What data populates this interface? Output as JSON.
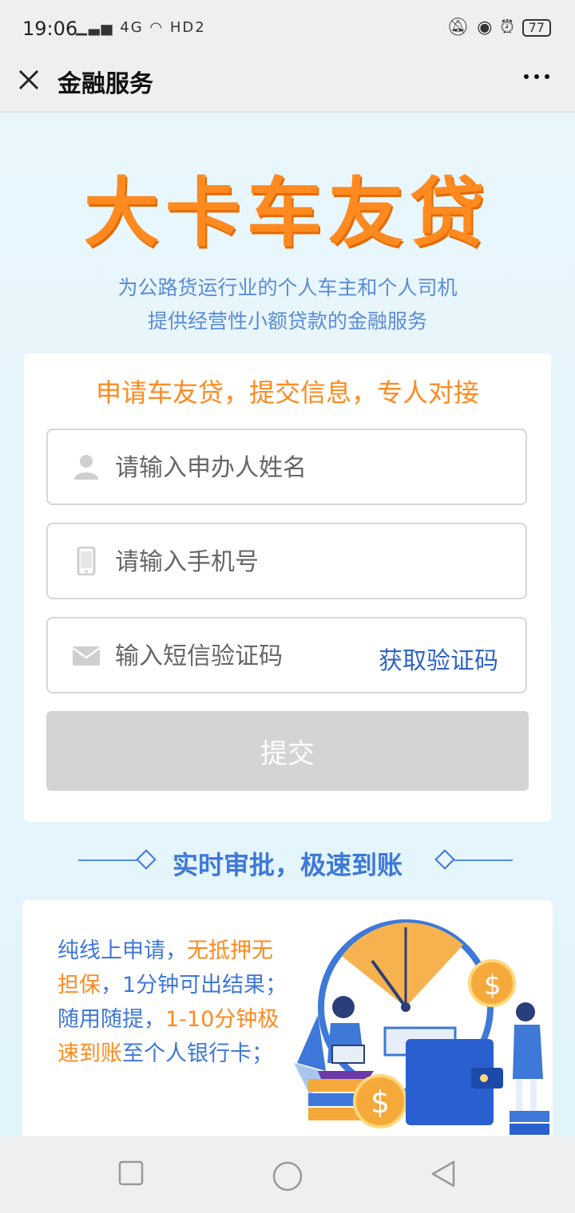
{
  "status": {
    "time": "19:06",
    "battery": "77",
    "network": "4G",
    "hd": "HD2"
  },
  "navbar": {
    "title": "金融服务"
  },
  "brand": {
    "title": "大卡车友贷",
    "subtitle_line1": "为公路货运行业的个人车主和个人司机",
    "subtitle_line2": "提供经营性小额贷款的金融服务"
  },
  "form": {
    "heading": "申请车友贷，提交信息，专人对接",
    "name_placeholder": "请输入申办人姓名",
    "phone_placeholder": "请输入手机号",
    "sms_placeholder": "输入短信验证码",
    "get_code_label": "获取验证码",
    "submit_label": "提交"
  },
  "divider": {
    "text": "实时审批，极速到账"
  },
  "feature": {
    "t1": "纯线上申请，",
    "h1": "无抵押无担保",
    "t2": "，1分钟可出结果；",
    "t3": "随用随提，",
    "h2": "1-10分钟极速到账",
    "t4": "至个人银行卡；"
  },
  "colors": {
    "accent": "#ff8a1f",
    "blue": "#3e78d8",
    "background": "#e9f6fc"
  },
  "icons": [
    "close-icon",
    "more-icon",
    "user-icon",
    "phone-icon",
    "mail-icon",
    "square-nav-icon",
    "circle-nav-icon",
    "back-triangle-icon"
  ]
}
